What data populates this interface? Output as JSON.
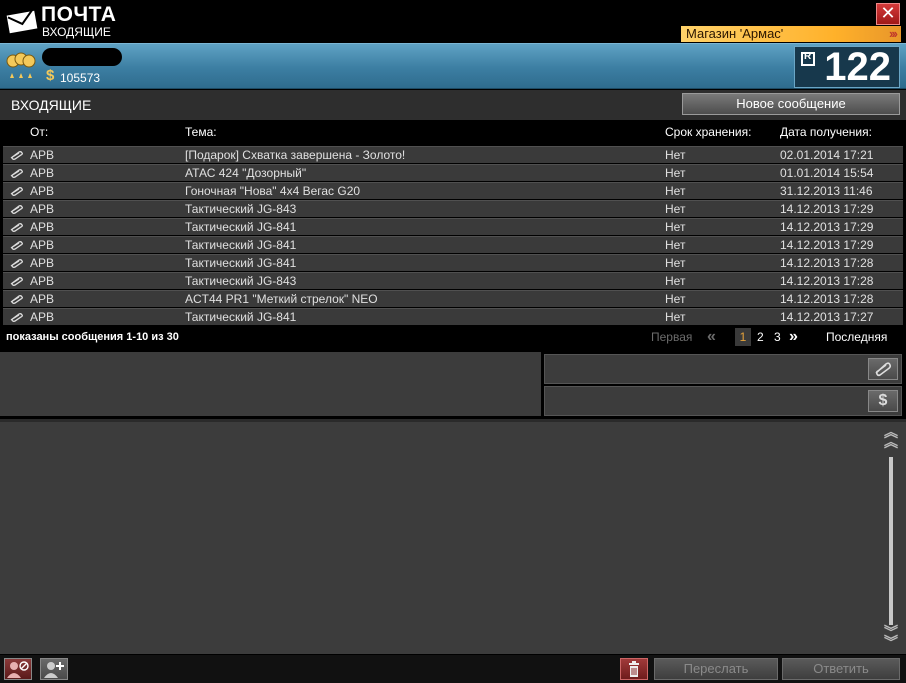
{
  "window": {
    "title": "ПОЧТА",
    "subtitle": "ВХОДЯЩИЕ",
    "close_label": "✕",
    "shop_tag": "Магазин 'Армас'",
    "shop_arrows": "›››"
  },
  "header": {
    "money_symbol": "$",
    "money": "105573",
    "message_count": "122"
  },
  "section": {
    "title": "ВХОДЯЩИЕ",
    "new_message_label": "Новое сообщение"
  },
  "table": {
    "columns": {
      "from": "От:",
      "subject": "Тема:",
      "storage": "Срок хранения:",
      "received": "Дата получения:"
    },
    "rows": [
      {
        "from": "АРВ",
        "subject": "[Подарок] Схватка завершена - Золото!",
        "storage": "Нет",
        "received": "02.01.2014 17:21"
      },
      {
        "from": "АРВ",
        "subject": "АТАС 424 \"Дозорный\"",
        "storage": "Нет",
        "received": "01.01.2014 15:54"
      },
      {
        "from": "АРВ",
        "subject": "Гоночная \"Нова\" 4x4 Вегас G20",
        "storage": "Нет",
        "received": "31.12.2013 11:46"
      },
      {
        "from": "АРВ",
        "subject": "Тактический JG-843",
        "storage": "Нет",
        "received": "14.12.2013 17:29"
      },
      {
        "from": "АРВ",
        "subject": "Тактический JG-841",
        "storage": "Нет",
        "received": "14.12.2013 17:29"
      },
      {
        "from": "АРВ",
        "subject": "Тактический JG-841",
        "storage": "Нет",
        "received": "14.12.2013 17:29"
      },
      {
        "from": "АРВ",
        "subject": "Тактический JG-841",
        "storage": "Нет",
        "received": "14.12.2013 17:28"
      },
      {
        "from": "АРВ",
        "subject": "Тактический JG-843",
        "storage": "Нет",
        "received": "14.12.2013 17:28"
      },
      {
        "from": "АРВ",
        "subject": "ACT44 PR1 \"Меткий стрелок\" NEO",
        "storage": "Нет",
        "received": "14.12.2013 17:28"
      },
      {
        "from": "АРВ",
        "subject": "Тактический JG-841",
        "storage": "Нет",
        "received": "14.12.2013 17:27"
      }
    ]
  },
  "pager": {
    "info": "показаны сообщения 1-10 из 30",
    "first": "Первая",
    "prev": "«",
    "pages": [
      "1",
      "2",
      "3"
    ],
    "current_page": "1",
    "next": "»",
    "last": "Последняя"
  },
  "preview": {
    "money_symbol": "$"
  },
  "actions": {
    "forward_label": "Переслать",
    "reply_label": "Ответить"
  },
  "colors": {
    "header_blue": "#3c7ea2",
    "shop_orange": "#ffb12a",
    "close_red": "#c0392b",
    "active_page": "#e5a23a"
  }
}
